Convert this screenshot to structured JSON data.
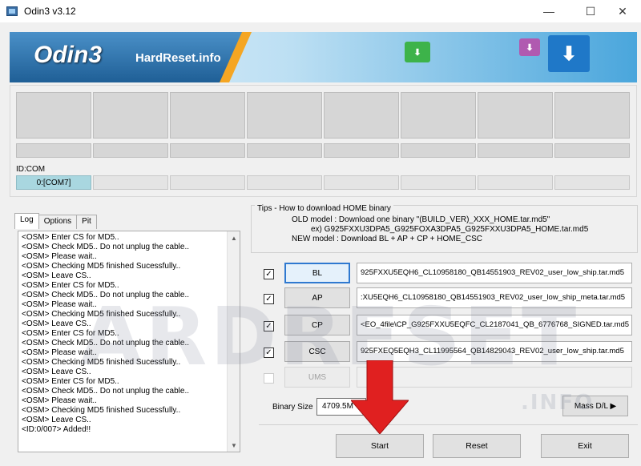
{
  "window": {
    "title": "Odin3 v3.12",
    "min_glyph": "—",
    "max_glyph": "☐",
    "close_glyph": "✕"
  },
  "banner": {
    "logo": "Odin3",
    "subtitle": "HardReset.info"
  },
  "ports": {
    "id_label": "ID:COM",
    "active_port": "0:[COM7]"
  },
  "tabs": [
    {
      "label": "Log"
    },
    {
      "label": "Options"
    },
    {
      "label": "Pit"
    }
  ],
  "log": {
    "lines": [
      "<OSM> Enter CS for MD5..",
      "<OSM> Check MD5.. Do not unplug the cable..",
      "<OSM> Please wait..",
      "<OSM> Checking MD5 finished Sucessfully..",
      "<OSM> Leave CS..",
      "<OSM> Enter CS for MD5..",
      "<OSM> Check MD5.. Do not unplug the cable..",
      "<OSM> Please wait..",
      "<OSM> Checking MD5 finished Sucessfully..",
      "<OSM> Leave CS..",
      "<OSM> Enter CS for MD5..",
      "<OSM> Check MD5.. Do not unplug the cable..",
      "<OSM> Please wait..",
      "<OSM> Checking MD5 finished Sucessfully..",
      "<OSM> Leave CS..",
      "<OSM> Enter CS for MD5..",
      "<OSM> Check MD5.. Do not unplug the cable..",
      "<OSM> Please wait..",
      "<OSM> Checking MD5 finished Sucessfully..",
      "<OSM> Leave CS..",
      "<ID:0/007> Added!!"
    ]
  },
  "tips": {
    "title": "Tips - How to download HOME binary",
    "line1": "OLD model  : Download one binary    \"(BUILD_VER)_XXX_HOME.tar.md5\"",
    "line2": "ex) G925FXXU3DPA5_G925FOXA3DPA5_G925FXXU3DPA5_HOME.tar.md5",
    "line3": "NEW model : Download BL + AP + CP + HOME_CSC"
  },
  "files": [
    {
      "label": "BL",
      "checked": "✓",
      "path": "925FXXU5EQH6_CL10958180_QB14551903_REV02_user_low_ship.tar.md5"
    },
    {
      "label": "AP",
      "checked": "✓",
      "path": ":XU5EQH6_CL10958180_QB14551903_REV02_user_low_ship_meta.tar.md5"
    },
    {
      "label": "CP",
      "checked": "✓",
      "path": "<EO_4file\\CP_G925FXXU5EQFC_CL2187041_QB_6776768_SIGNED.tar.md5"
    },
    {
      "label": "CSC",
      "checked": "✓",
      "path": "925FXEQ5EQH3_CL11995564_QB14829043_REV02_user_low_ship.tar.md5"
    },
    {
      "label": "UMS",
      "checked": "",
      "path": ""
    }
  ],
  "binary": {
    "label": "Binary Size",
    "value": "4709.5M"
  },
  "buttons": {
    "mass_dl": "Mass D/L ▶",
    "start": "Start",
    "reset": "Reset",
    "exit": "Exit"
  },
  "watermark": {
    "text": "ARDRESET",
    "sub": ".INFO"
  },
  "colors": {
    "active_port": "#a9d7e0",
    "selected_button_border": "#2f79d0",
    "arrow": "#e02020"
  }
}
